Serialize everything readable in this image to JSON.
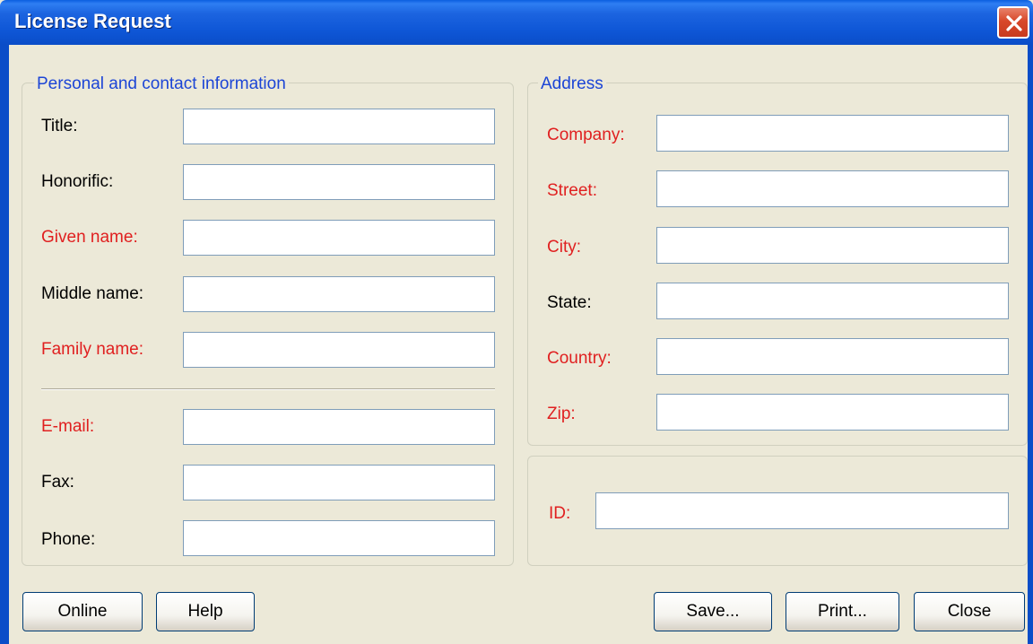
{
  "window": {
    "title": "License Request"
  },
  "personal": {
    "legend": "Personal and contact information",
    "title_label": "Title:",
    "honorific_label": "Honorific:",
    "given_name_label": "Given name:",
    "middle_name_label": "Middle name:",
    "family_name_label": "Family name:",
    "email_label": "E-mail:",
    "fax_label": "Fax:",
    "phone_label": "Phone:"
  },
  "address": {
    "legend": "Address",
    "company_label": "Company:",
    "street_label": "Street:",
    "city_label": "City:",
    "state_label": "State:",
    "country_label": "Country:",
    "zip_label": "Zip:"
  },
  "id_group": {
    "id_label": "ID:"
  },
  "buttons": {
    "online": "Online",
    "help": "Help",
    "save": "Save...",
    "print": "Print...",
    "close": "Close"
  },
  "colors": {
    "required_label": "#E02020",
    "legend_text": "#1C45D6",
    "titlebar": "#0A4DC8",
    "dialog_background": "#ECE9D8"
  }
}
